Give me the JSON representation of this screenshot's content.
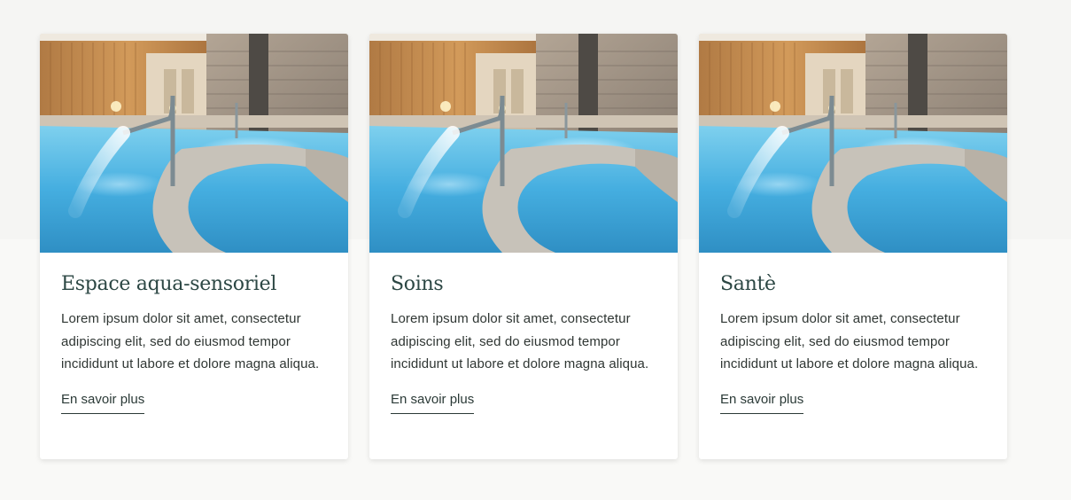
{
  "cards": [
    {
      "title": "Espace aqua-sensoriel",
      "text": "Lorem ipsum dolor sit amet, consectetur adipiscing elit, sed do eiusmod tempor incididunt ut labore et dolore magna aliqua.",
      "link_label": "En savoir plus"
    },
    {
      "title": "Soins",
      "text": "Lorem ipsum dolor sit amet, consectetur adipiscing elit, sed do eiusmod tempor incididunt ut labore et dolore magna aliqua.",
      "link_label": "En savoir plus"
    },
    {
      "title": "Santè",
      "text": "Lorem ipsum dolor sit amet, consectetur adipiscing elit, sed do eiusmod tempor incididunt ut labore et dolore magna aliqua.",
      "link_label": "En savoir plus"
    }
  ],
  "colors": {
    "title": "#2c4744",
    "text": "#2f3633",
    "background": "#f9f9f7",
    "pool_water": "#4fb3dd"
  }
}
